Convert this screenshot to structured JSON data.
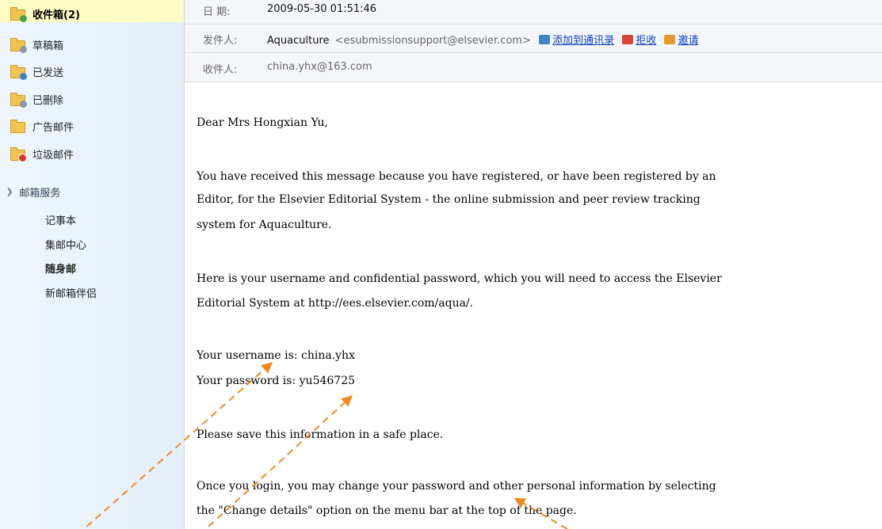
{
  "sidebar": {
    "folders": [
      {
        "label": "收件箱(2)",
        "icon": "inbox-icon"
      },
      {
        "label": "草稿箱",
        "icon": "drafts-icon"
      },
      {
        "label": "已发送",
        "icon": "sent-icon"
      },
      {
        "label": "已删除",
        "icon": "deleted-icon"
      },
      {
        "label": "广告邮件",
        "icon": "ads-icon"
      },
      {
        "label": "垃圾邮件",
        "icon": "spam-icon"
      }
    ],
    "services_title": "邮箱服务",
    "services": [
      "记事本",
      "集邮中心",
      "随身邮",
      "新邮箱伴侣"
    ]
  },
  "header": {
    "date_label": "日    期:",
    "date_value": "2009-05-30 01:51:46",
    "from_label": "发件人:",
    "from_name": "Aquaculture",
    "from_email": "<esubmissionsupport@elsevier.com>",
    "add_contact": "添加到通讯录",
    "reject": "拒收",
    "invite": "邀请",
    "to_label": "收件人:",
    "to_value": "china.yhx@163.com"
  },
  "body": [
    "Dear Mrs Hongxian Yu,",
    "You have received this message because you have registered, or have been registered by an",
    "Editor, for the Elsevier Editorial System - the online submission and peer review tracking",
    "system for Aquaculture.",
    "Here is your username and confidential password, which you will need to access the Elsevier",
    "Editorial System at http://ees.elsevier.com/aqua/.",
    "Your username is: china.yhx",
    "Your password is: yu546725",
    "Please save this information in a safe place.",
    "Once you login, you may change your password and other personal information by selecting",
    "the \"Change details\" option on the menu bar at the top of the page."
  ],
  "colors": {
    "annotation": "#f08a1e",
    "link": "#0b3ec2",
    "sidebar_bg": "#e9f2fb",
    "inbox_highlight": "#fdfcc4"
  }
}
